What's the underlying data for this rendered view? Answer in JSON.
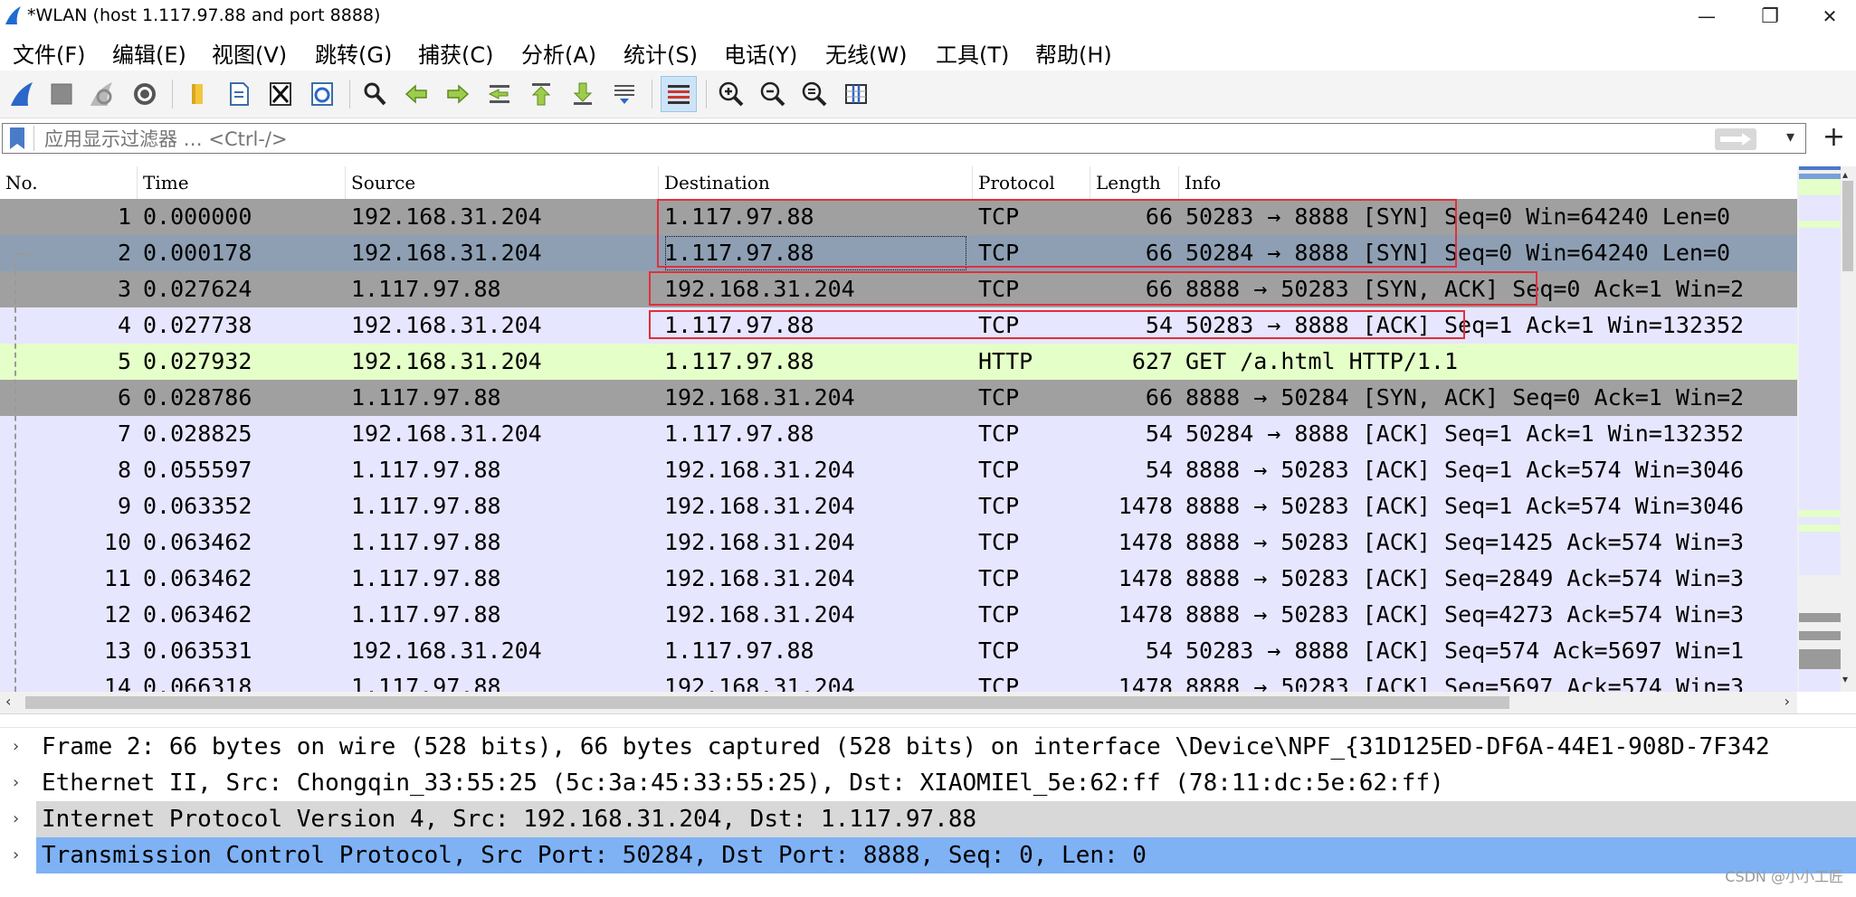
{
  "window": {
    "title": "*WLAN (host 1.117.97.88 and port 8888)",
    "minimize": "—",
    "restore": "❐",
    "close": "✕"
  },
  "menu": [
    {
      "label": "文件(F)"
    },
    {
      "label": "编辑(E)"
    },
    {
      "label": "视图(V)"
    },
    {
      "label": "跳转(G)"
    },
    {
      "label": "捕获(C)"
    },
    {
      "label": "分析(A)"
    },
    {
      "label": "统计(S)"
    },
    {
      "label": "电话(Y)"
    },
    {
      "label": "无线(W)"
    },
    {
      "label": "工具(T)"
    },
    {
      "label": "帮助(H)"
    }
  ],
  "filter": {
    "placeholder": "应用显示过滤器 … <Ctrl-/>"
  },
  "columns": {
    "no": "No.",
    "time": "Time",
    "source": "Source",
    "destination": "Destination",
    "protocol": "Protocol",
    "length": "Length",
    "info": "Info"
  },
  "packets": [
    {
      "no": "1",
      "time": "0.000000",
      "source": "192.168.31.204",
      "destination": "1.117.97.88",
      "protocol": "TCP",
      "length": "66",
      "info": "50283 → 8888 [SYN] Seq=0 Win=64240 Len=0",
      "bg": "#a0a0a0"
    },
    {
      "no": "2",
      "time": "0.000178",
      "source": "192.168.31.204",
      "destination": "1.117.97.88",
      "protocol": "TCP",
      "length": "66",
      "info": "50284 → 8888 [SYN] Seq=0 Win=64240 Len=0",
      "bg": "#8e9fb3"
    },
    {
      "no": "3",
      "time": "0.027624",
      "source": "1.117.97.88",
      "destination": "192.168.31.204",
      "protocol": "TCP",
      "length": "66",
      "info": "8888 → 50283 [SYN, ACK] Seq=0 Ack=1 Win=2",
      "bg": "#a0a0a0"
    },
    {
      "no": "4",
      "time": "0.027738",
      "source": "192.168.31.204",
      "destination": "1.117.97.88",
      "protocol": "TCP",
      "length": "54",
      "info": "50283 → 8888 [ACK] Seq=1 Ack=1 Win=132352",
      "bg": "#e7e6ff"
    },
    {
      "no": "5",
      "time": "0.027932",
      "source": "192.168.31.204",
      "destination": "1.117.97.88",
      "protocol": "HTTP",
      "length": "627",
      "info": "GET /a.html HTTP/1.1",
      "bg": "#e4ffc7"
    },
    {
      "no": "6",
      "time": "0.028786",
      "source": "1.117.97.88",
      "destination": "192.168.31.204",
      "protocol": "TCP",
      "length": "66",
      "info": "8888 → 50284 [SYN, ACK] Seq=0 Ack=1 Win=2",
      "bg": "#a0a0a0"
    },
    {
      "no": "7",
      "time": "0.028825",
      "source": "192.168.31.204",
      "destination": "1.117.97.88",
      "protocol": "TCP",
      "length": "54",
      "info": "50284 → 8888 [ACK] Seq=1 Ack=1 Win=132352",
      "bg": "#e7e6ff"
    },
    {
      "no": "8",
      "time": "0.055597",
      "source": "1.117.97.88",
      "destination": "192.168.31.204",
      "protocol": "TCP",
      "length": "54",
      "info": "8888 → 50283 [ACK] Seq=1 Ack=574 Win=3046",
      "bg": "#e7e6ff"
    },
    {
      "no": "9",
      "time": "0.063352",
      "source": "1.117.97.88",
      "destination": "192.168.31.204",
      "protocol": "TCP",
      "length": "1478",
      "info": "8888 → 50283 [ACK] Seq=1 Ack=574 Win=3046",
      "bg": "#e7e6ff"
    },
    {
      "no": "10",
      "time": "0.063462",
      "source": "1.117.97.88",
      "destination": "192.168.31.204",
      "protocol": "TCP",
      "length": "1478",
      "info": "8888 → 50283 [ACK] Seq=1425 Ack=574 Win=3",
      "bg": "#e7e6ff"
    },
    {
      "no": "11",
      "time": "0.063462",
      "source": "1.117.97.88",
      "destination": "192.168.31.204",
      "protocol": "TCP",
      "length": "1478",
      "info": "8888 → 50283 [ACK] Seq=2849 Ack=574 Win=3",
      "bg": "#e7e6ff"
    },
    {
      "no": "12",
      "time": "0.063462",
      "source": "1.117.97.88",
      "destination": "192.168.31.204",
      "protocol": "TCP",
      "length": "1478",
      "info": "8888 → 50283 [ACK] Seq=4273 Ack=574 Win=3",
      "bg": "#e7e6ff"
    },
    {
      "no": "13",
      "time": "0.063531",
      "source": "192.168.31.204",
      "destination": "1.117.97.88",
      "protocol": "TCP",
      "length": "54",
      "info": "50283 → 8888 [ACK] Seq=574 Ack=5697 Win=1",
      "bg": "#e7e6ff"
    },
    {
      "no": "14",
      "time": "0.066318",
      "source": "1.117.97.88",
      "destination": "192.168.31.204",
      "protocol": "TCP",
      "length": "1478",
      "info": "8888 → 50283 [ACK] Seq=5697 Ack=574 Win=3",
      "bg": "#e7e6ff"
    }
  ],
  "details": [
    {
      "text": "Frame 2: 66 bytes on wire (528 bits), 66 bytes captured (528 bits) on interface \\Device\\NPF_{31D125ED-DF6A-44E1-908D-7F342",
      "bg": "#ffffff"
    },
    {
      "text": "Ethernet II, Src: Chongqin_33:55:25 (5c:3a:45:33:55:25), Dst: XIAOMIEl_5e:62:ff (78:11:dc:5e:62:ff)",
      "bg": "#ffffff"
    },
    {
      "text": "Internet Protocol Version 4, Src: 192.168.31.204, Dst: 1.117.97.88",
      "bg": "#d8d8d8"
    },
    {
      "text": "Transmission Control Protocol, Src Port: 50284, Dst Port: 8888, Seq: 0, Len: 0",
      "bg": "#7fb2f5"
    }
  ],
  "watermark": "CSDN @小小工匠",
  "colors": {
    "selected_row": "#8e9fb3",
    "tcp_syn": "#a0a0a0",
    "tcp": "#e7e6ff",
    "http": "#e4ffc7",
    "marker": "#e0303c"
  }
}
